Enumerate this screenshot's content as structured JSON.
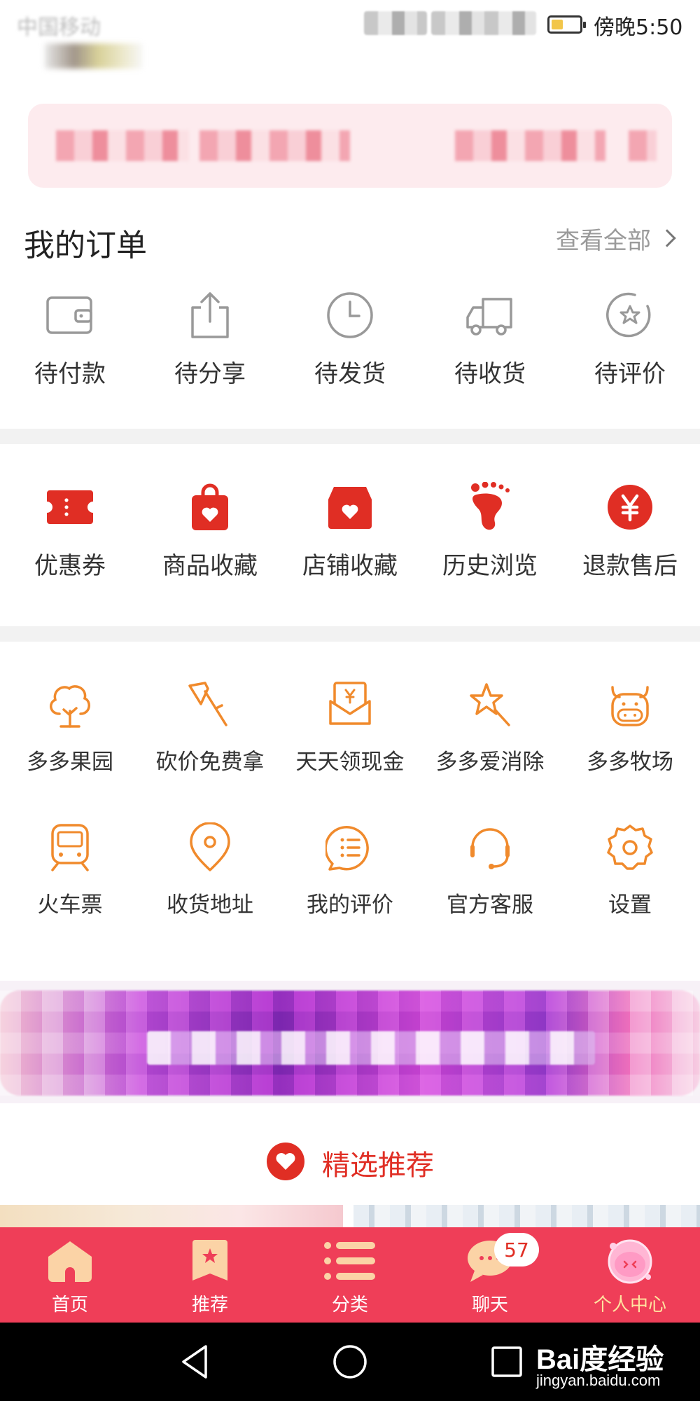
{
  "status_bar": {
    "carrier": "中国移动",
    "time": "傍晚5:50"
  },
  "orders": {
    "title": "我的订单",
    "view_all": "查看全部",
    "items": [
      {
        "label": "待付款",
        "icon": "wallet-icon"
      },
      {
        "label": "待分享",
        "icon": "share-icon"
      },
      {
        "label": "待发货",
        "icon": "clock-icon"
      },
      {
        "label": "待收货",
        "icon": "truck-icon"
      },
      {
        "label": "待评价",
        "icon": "review-star-icon"
      }
    ]
  },
  "services": {
    "items": [
      {
        "label": "优惠券",
        "icon": "coupon-icon"
      },
      {
        "label": "商品收藏",
        "icon": "bag-heart-icon"
      },
      {
        "label": "店铺收藏",
        "icon": "shop-heart-icon"
      },
      {
        "label": "历史浏览",
        "icon": "footprint-icon"
      },
      {
        "label": "退款售后",
        "icon": "refund-yen-icon"
      }
    ]
  },
  "tools": {
    "row1": [
      {
        "label": "多多果园",
        "icon": "tree-icon"
      },
      {
        "label": "砍价免费拿",
        "icon": "axe-icon"
      },
      {
        "label": "天天领现金",
        "icon": "cash-envelope-icon"
      },
      {
        "label": "多多爱消除",
        "icon": "star-wand-icon"
      },
      {
        "label": "多多牧场",
        "icon": "cow-icon"
      }
    ],
    "row2": [
      {
        "label": "火车票",
        "icon": "train-icon"
      },
      {
        "label": "收货地址",
        "icon": "location-pin-icon"
      },
      {
        "label": "我的评价",
        "icon": "comment-icon"
      },
      {
        "label": "官方客服",
        "icon": "headset-icon"
      },
      {
        "label": "设置",
        "icon": "gear-icon"
      }
    ]
  },
  "recommend": {
    "label": "精选推荐",
    "icon": "heart-badge-icon"
  },
  "tabbar": {
    "items": [
      {
        "label": "首页",
        "icon": "home-icon"
      },
      {
        "label": "推荐",
        "icon": "recommend-icon"
      },
      {
        "label": "分类",
        "icon": "category-list-icon"
      },
      {
        "label": "聊天",
        "icon": "chat-icon",
        "badge": "57"
      },
      {
        "label": "个人中心",
        "icon": "profile-avatar-icon",
        "active": true
      }
    ]
  },
  "watermark": {
    "main": "Bai度经验",
    "sub": "jingyan.baidu.com"
  },
  "colors": {
    "brand_red": "#e02e24",
    "tab_bar": "#ef3e58",
    "tool_orange": "#f08a2c",
    "order_gray": "#999999"
  }
}
